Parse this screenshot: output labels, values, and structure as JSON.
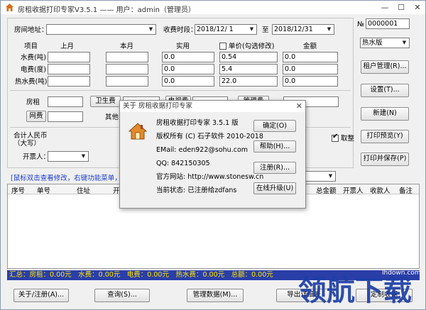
{
  "window": {
    "title": "房租收据打印专家V3.5.1 —— 用户：admin（管理员）",
    "minimize": "—",
    "maximize": "☐",
    "close": "✕"
  },
  "form": {
    "room_addr_label": "房间地址：",
    "period_label": "收费时段：",
    "date_from": "2018/12/ 1",
    "to_label": "至",
    "date_to": "2018/12/31",
    "receipt_no_label": "№",
    "receipt_no": "0000001",
    "table_headers": {
      "item": "项目",
      "last": "上月",
      "this": "本月",
      "actual": "实用",
      "unit_price": "单价(勾选修改)",
      "amount": "金额"
    },
    "rows": [
      {
        "label": "水费(吨)",
        "actual": "0.0",
        "unit": "0.54",
        "amount": "0.0"
      },
      {
        "label": "电费(度)",
        "actual": "0.0",
        "unit": "5.4",
        "amount": "0.0"
      },
      {
        "label": "热水费(吨)",
        "actual": "0.0",
        "unit": "22.0",
        "amount": "0.0"
      }
    ],
    "rent_label": "房租",
    "sanitation_label": "卫生费",
    "tv_label": "电视费",
    "mgmt_label": "管理费",
    "network_label": "网费",
    "other_label": "其他",
    "total_label": "合计人民币（大写）",
    "round_label": "取整",
    "issuer_label": "开票人："
  },
  "side": {
    "type_select": "热水版",
    "buttons": [
      "租户管理(R)...",
      "设置(T)...",
      "新建(N)",
      "打印预览(Y)",
      "打印并保存(P)"
    ]
  },
  "hint": "[鼠标双击查看修改，右键功能菜单，可按住",
  "grid": {
    "columns": [
      "序号",
      "单号",
      "住址",
      "开票",
      "总金额",
      "开票人",
      "收款人",
      "备注"
    ]
  },
  "status": "汇总：房租：0.00元　水费：0.00元　电费：0.00元　热水费：0.00元　总额：0.00元",
  "bottom_buttons": [
    "关于/注册(A)...",
    "查询(S)...",
    "管理数据(M)...",
    "导出详细表",
    "定制收据"
  ],
  "about": {
    "title": "关于 房租收据打印专家",
    "close": "✕",
    "lines": [
      "房租收据打印专家 3.5.1 版",
      "版权所有 (C) 石子软件 2010-2018",
      "EMail: eden922@sohu.com",
      "QQ: 842150305",
      "官方网站: http://www.stonesw.cn",
      "当前状态: 已注册给zdfans"
    ],
    "buttons": [
      "确定(O)",
      "帮助(H)...",
      "注册(R)...",
      "在线升级(U)"
    ]
  },
  "watermark": {
    "site": "lhdown.com",
    "brand": "领航下载"
  }
}
